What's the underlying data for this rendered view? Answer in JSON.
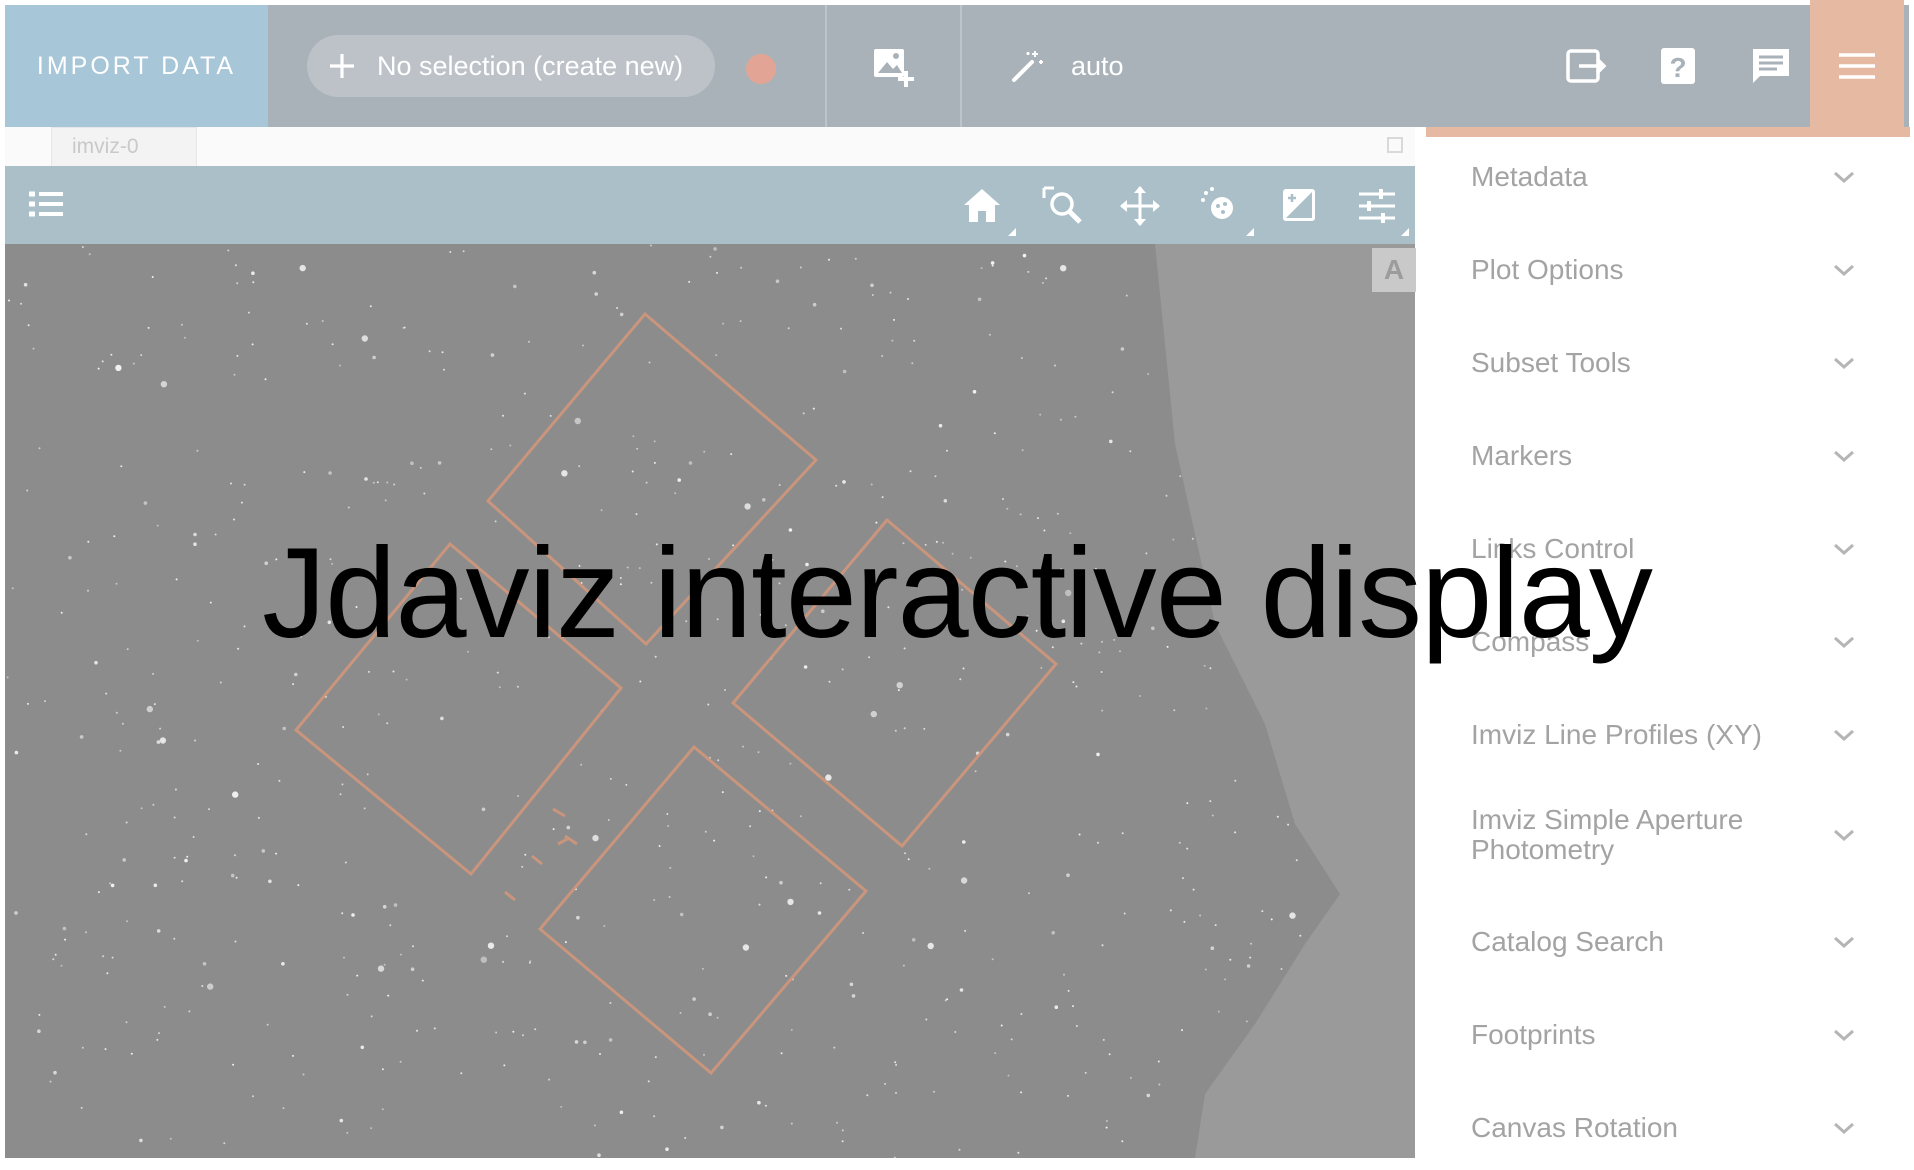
{
  "topbar": {
    "import_label": "IMPORT DATA",
    "subset_label": "No selection (create new)",
    "subset_color": "#e2a595",
    "layout_label": "auto",
    "icons": [
      "plus-icon",
      "add-image-icon",
      "magic-wand-icon",
      "export-icon",
      "help-icon",
      "comment-icon",
      "hamburger-menu-icon"
    ]
  },
  "viewer": {
    "tab_label": "imviz-0",
    "toolbar_icons": [
      "layer-list-icon",
      "home-icon",
      "zoom-icon",
      "pan-icon",
      "stretch-icon",
      "contrast-icon",
      "settings-sliders-icon"
    ],
    "a_button_label": "A"
  },
  "tray": {
    "items": [
      {
        "label": "Metadata"
      },
      {
        "label": "Plot Options"
      },
      {
        "label": "Subset Tools"
      },
      {
        "label": "Markers"
      },
      {
        "label": "Links Control"
      },
      {
        "label": "Compass"
      },
      {
        "label": "Imviz Line Profiles (XY)"
      },
      {
        "label": "Imviz Simple Aperture Photometry"
      },
      {
        "label": "Catalog Search"
      },
      {
        "label": "Footprints"
      },
      {
        "label": "Canvas Rotation"
      }
    ]
  },
  "colors": {
    "accent": "#e6b9a2",
    "footprint": "#d4977a",
    "toolbar": "#abbfc8"
  },
  "overlay": {
    "title": "Jdaviz interactive display"
  }
}
